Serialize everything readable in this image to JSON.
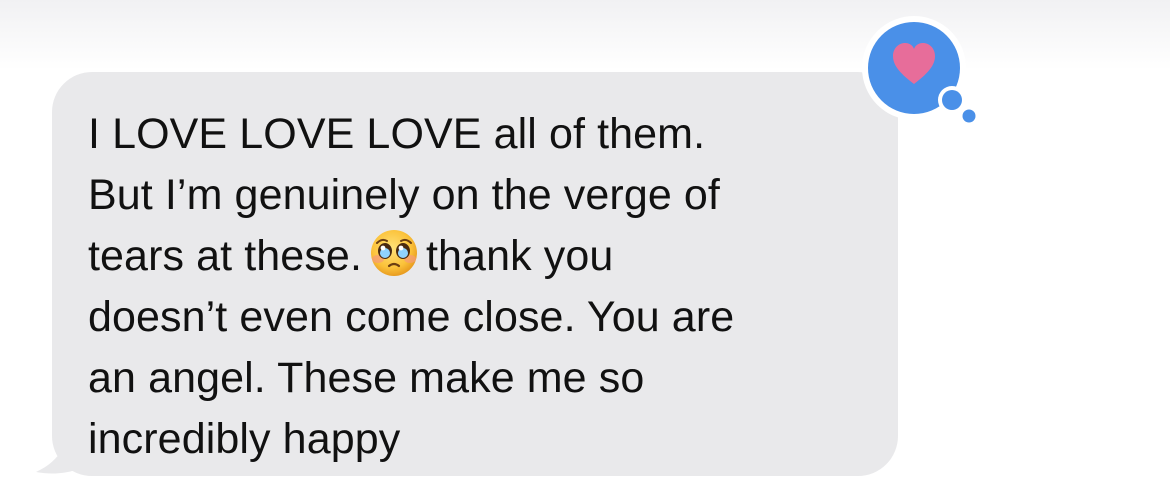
{
  "message": {
    "sender": "incoming",
    "lines": [
      "I LOVE LOVE LOVE all of them.",
      "But I’m genuinely on the verge of",
      "tears at these.",
      "thank you",
      "doesn’t even come close. You are",
      "an angel. These make me so",
      "incredibly happy"
    ],
    "emoji": "pleading-face",
    "bubble_color": "#e9e9eb",
    "text_color": "#111111"
  },
  "tapback": {
    "reaction": "heart",
    "bubble_color": "#4a90e8",
    "heart_color": "#e76d9a"
  }
}
